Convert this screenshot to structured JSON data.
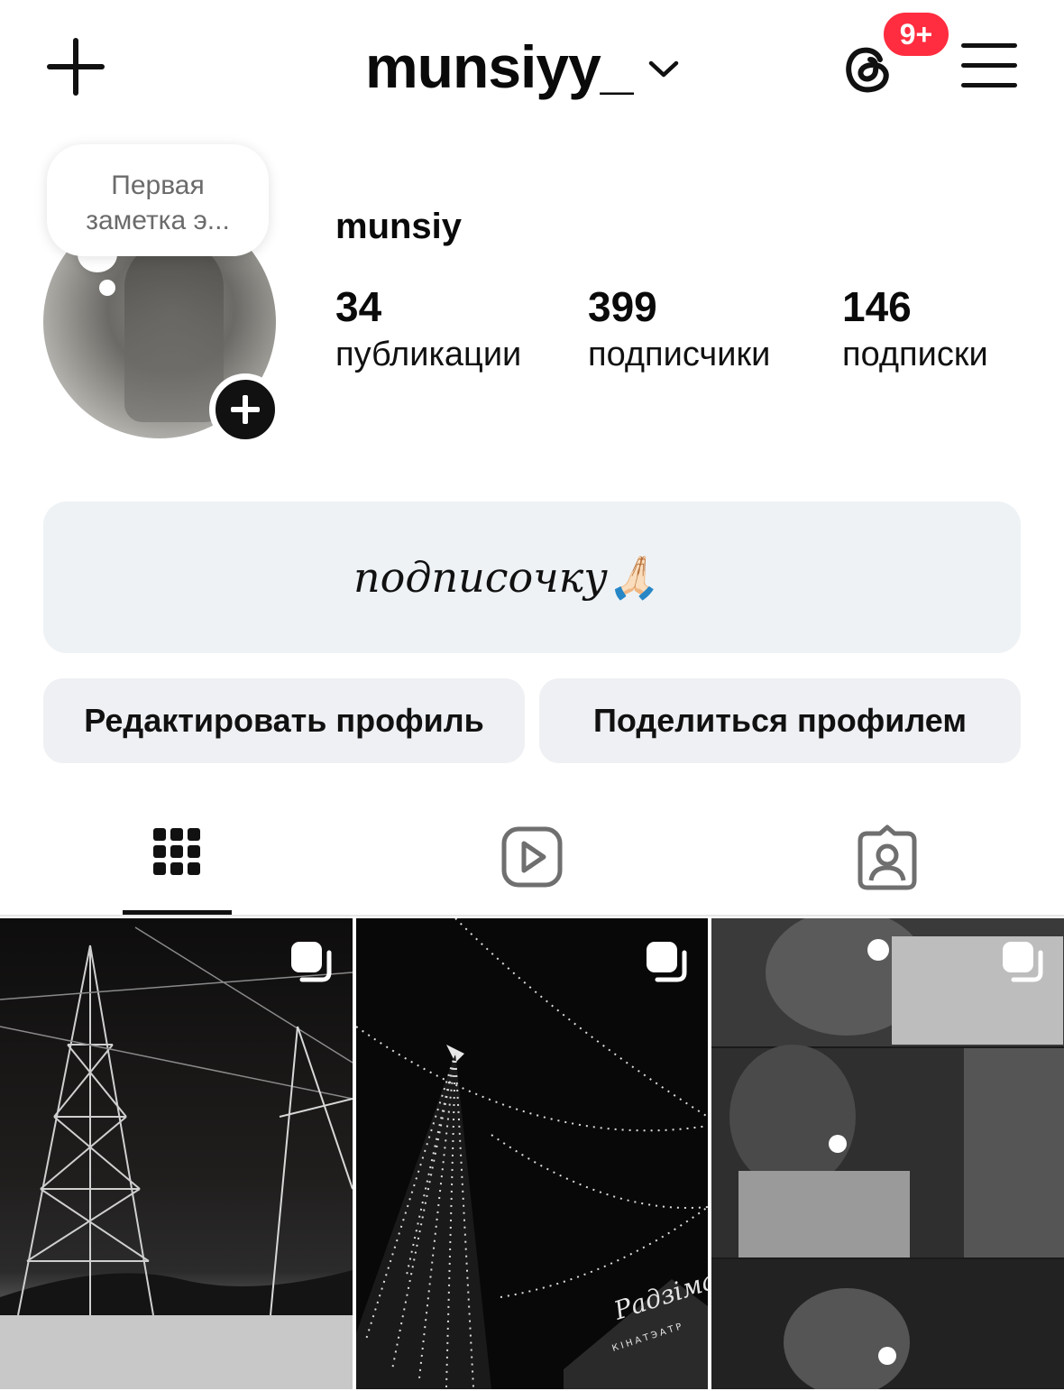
{
  "header": {
    "username": "munsiyy_",
    "notification_badge": "9+",
    "icons": [
      "plus-icon",
      "chevron-down-icon",
      "threads-icon",
      "menu-icon"
    ]
  },
  "note": {
    "line1": "Первая",
    "line2": "заметка э..."
  },
  "profile": {
    "display_name": "munsiy",
    "stats": [
      {
        "value": "34",
        "label": "публикации"
      },
      {
        "value": "399",
        "label": "подписчики"
      },
      {
        "value": "146",
        "label": "подписки"
      }
    ],
    "bio": "подписочку🙏🏻"
  },
  "actions": {
    "edit_label": "Редактировать профиль",
    "share_label": "Поделиться профилем"
  },
  "tabs": [
    {
      "name": "grid-icon",
      "active": true
    },
    {
      "name": "reels-icon",
      "active": false
    },
    {
      "name": "tagged-icon",
      "active": false
    }
  ],
  "posts": [
    {
      "subject": "power line tower at night",
      "multi": true
    },
    {
      "subject": "christmas tree lights",
      "multi": true
    },
    {
      "subject": "photo collage",
      "multi": true
    }
  ],
  "post_overlay_text": {
    "cinema_name": "Радзіма",
    "cinema_sign": "КІНАТЭАТР"
  },
  "colors": {
    "badge": "#ff2d3f",
    "bio_bg": "#eef2f5",
    "button_bg": "#eff0f3"
  }
}
